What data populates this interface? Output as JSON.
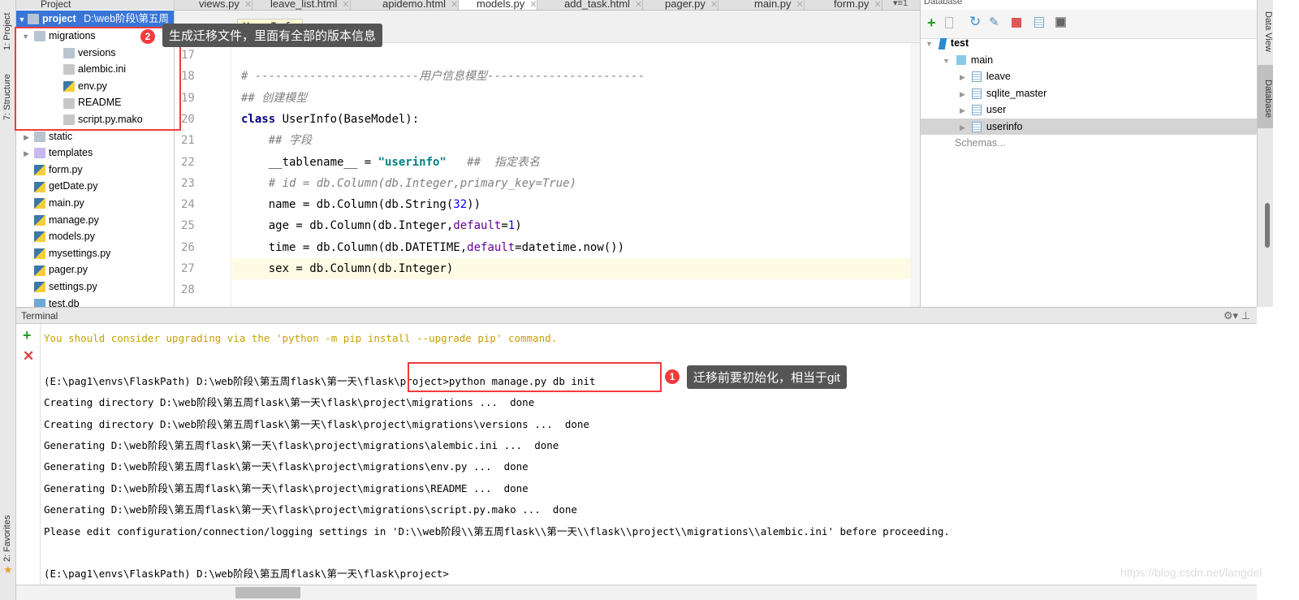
{
  "left_strip": {
    "project": "1: Project",
    "structure": "7: Structure",
    "favorites": "2: Favorites"
  },
  "project": {
    "header": "Project",
    "root": {
      "name": "project",
      "path": "D:\\web阶段\\第五周"
    },
    "items": [
      {
        "label": "migrations",
        "type": "folder",
        "depth": 1,
        "expanded": true
      },
      {
        "label": "versions",
        "type": "folder",
        "depth": 2
      },
      {
        "label": "alembic.ini",
        "type": "ini",
        "depth": 2
      },
      {
        "label": "env.py",
        "type": "py",
        "depth": 2
      },
      {
        "label": "README",
        "type": "text",
        "depth": 2
      },
      {
        "label": "script.py.mako",
        "type": "mako",
        "depth": 2
      },
      {
        "label": "static",
        "type": "folder",
        "depth": 1,
        "expanded": false
      },
      {
        "label": "templates",
        "type": "folder",
        "depth": 1,
        "expanded": false
      },
      {
        "label": "form.py",
        "type": "py",
        "depth": 1
      },
      {
        "label": "getDate.py",
        "type": "py",
        "depth": 1
      },
      {
        "label": "main.py",
        "type": "py",
        "depth": 1
      },
      {
        "label": "manage.py",
        "type": "py",
        "depth": 1
      },
      {
        "label": "models.py",
        "type": "py",
        "depth": 1
      },
      {
        "label": "mysettings.py",
        "type": "py",
        "depth": 1
      },
      {
        "label": "pager.py",
        "type": "py",
        "depth": 1
      },
      {
        "label": "settings.py",
        "type": "py",
        "depth": 1
      },
      {
        "label": "test.db",
        "type": "db",
        "depth": 1
      }
    ]
  },
  "tabs": [
    {
      "label": "views.py"
    },
    {
      "label": "leave_list.html"
    },
    {
      "label": "apidemo.html"
    },
    {
      "label": "models.py",
      "active": true
    },
    {
      "label": "add_task.html"
    },
    {
      "label": "pager.py"
    },
    {
      "label": "main.py"
    },
    {
      "label": "form.py"
    }
  ],
  "tabs_overflow": "▾≡1",
  "breadcrumb": "UserInfo",
  "code": {
    "lines": [
      {
        "n": "17",
        "html": ""
      },
      {
        "n": "18",
        "html": "<span class='cm'># ------------------------用户信息模型-----------------------</span>"
      },
      {
        "n": "19",
        "html": "<span class='cm'>## 创建模型</span>"
      },
      {
        "n": "20",
        "html": "<span class='kw'>class</span> UserInfo(BaseModel):"
      },
      {
        "n": "21",
        "html": "    <span class='cm'>## 字段</span>"
      },
      {
        "n": "22",
        "html": "    __tablename__ = <span class='str'>\"userinfo\"</span>   <span class='cm'>##  指定表名</span>"
      },
      {
        "n": "23",
        "html": "    <span class='cm'># id = db.Column(db.Integer,primary_key=True)</span>"
      },
      {
        "n": "24",
        "html": "    name = db.Column(db.String(<span class='num'>32</span>))"
      },
      {
        "n": "25",
        "html": "    age = db.Column(db.Integer,<span class='kwarg'>default</span>=<span class='num'>1</span>)"
      },
      {
        "n": "26",
        "html": "    time = db.Column(db.DATETIME,<span class='kwarg'>default</span>=datetime.now())"
      },
      {
        "n": "27",
        "html": "    sex = db.Column(db.Integer)"
      },
      {
        "n": "28",
        "html": ""
      }
    ],
    "current_line": "27"
  },
  "database": {
    "title": "Database",
    "tree": [
      {
        "label": "test",
        "depth": 0,
        "bold": true
      },
      {
        "label": "main",
        "depth": 1
      },
      {
        "label": "leave",
        "depth": 2
      },
      {
        "label": "sqlite_master",
        "depth": 2
      },
      {
        "label": "user",
        "depth": 2
      },
      {
        "label": "userinfo",
        "depth": 2,
        "selected": true
      }
    ],
    "schemas_link": "Schemas..."
  },
  "right_strip": {
    "data_view": "Data View",
    "database": "Database"
  },
  "terminal": {
    "title": "Terminal",
    "lines": [
      {
        "text": "You should consider upgrading via the 'python -m pip install --upgrade pip' command.",
        "warn": true
      },
      {
        "text": ""
      },
      {
        "text": "(E:\\pag1\\envs\\FlaskPath) D:\\web阶段\\第五周flask\\第一天\\flask\\project>python manage.py db init"
      },
      {
        "text": "Creating directory D:\\web阶段\\第五周flask\\第一天\\flask\\project\\migrations ...  done"
      },
      {
        "text": "Creating directory D:\\web阶段\\第五周flask\\第一天\\flask\\project\\migrations\\versions ...  done"
      },
      {
        "text": "Generating D:\\web阶段\\第五周flask\\第一天\\flask\\project\\migrations\\alembic.ini ...  done"
      },
      {
        "text": "Generating D:\\web阶段\\第五周flask\\第一天\\flask\\project\\migrations\\env.py ...  done"
      },
      {
        "text": "Generating D:\\web阶段\\第五周flask\\第一天\\flask\\project\\migrations\\README ...  done"
      },
      {
        "text": "Generating D:\\web阶段\\第五周flask\\第一天\\flask\\project\\migrations\\script.py.mako ...  done"
      },
      {
        "text": "Please edit configuration/connection/logging settings in 'D:\\\\web阶段\\\\第五周flask\\\\第一天\\\\flask\\\\project\\\\migrations\\\\alembic.ini' before proceeding."
      },
      {
        "text": ""
      },
      {
        "text": "(E:\\pag1\\envs\\FlaskPath) D:\\web阶段\\第五周flask\\第一天\\flask\\project>"
      }
    ]
  },
  "annotations": [
    {
      "number": "1",
      "text": "迁移前要初始化，相当于git"
    },
    {
      "number": "2",
      "text": "生成迁移文件，里面有全部的版本信息"
    }
  ],
  "watermark": "https://blog.csdn.net/langdei",
  "colors": {
    "accent_selection": "#3875d7",
    "annotation_red": "#f03c3c",
    "warning_text": "#c8a000",
    "current_line_bg": "#fefbe5"
  }
}
